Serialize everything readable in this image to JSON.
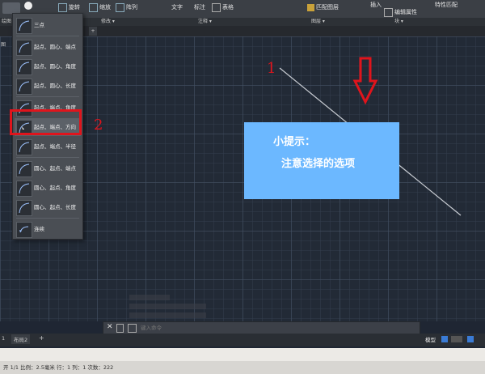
{
  "ribbon": {
    "buttons": [
      {
        "label": "旋转"
      },
      {
        "label": "缩放"
      },
      {
        "label": "阵列"
      },
      {
        "label": "文字"
      },
      {
        "label": "标注"
      },
      {
        "label": "表格"
      },
      {
        "label": "匹配图层"
      },
      {
        "label": "插入"
      },
      {
        "label": "编辑属性"
      },
      {
        "label": "特性匹配"
      }
    ],
    "panels": [
      "绘图 ▾",
      "修改 ▾",
      "注释 ▾",
      "图层 ▾",
      "块 ▾"
    ]
  },
  "tabs": {
    "add": "+"
  },
  "left_partial_text": "图",
  "arc_menu": {
    "items": [
      {
        "label": "三点"
      },
      {
        "label": "起点、圆心、端点"
      },
      {
        "label": "起点、圆心、角度"
      },
      {
        "label": "起点、圆心、长度"
      },
      {
        "label": "起点、端点、角度"
      },
      {
        "label": "起点、端点、方向"
      },
      {
        "label": "起点、端点、半径"
      },
      {
        "label": "圆心、起点、端点"
      },
      {
        "label": "圆心、起点、角度"
      },
      {
        "label": "圆心、起点、长度"
      },
      {
        "label": "连续"
      }
    ],
    "highlighted_index": 5
  },
  "annotations": {
    "label1": "1",
    "label2": "2",
    "highlight_color": "#e0141c"
  },
  "tip": {
    "title": "小提示：",
    "body": "注意选择的选项",
    "bg_color": "#6cb8ff"
  },
  "command": {
    "placeholder": "键入命令"
  },
  "layout_tabs": {
    "tab2": "布局2",
    "add": "+"
  },
  "status": {
    "model_label": "模型",
    "coords": "开 1/1  比例：2.5毫米  行：1  列：1  次数：222"
  }
}
